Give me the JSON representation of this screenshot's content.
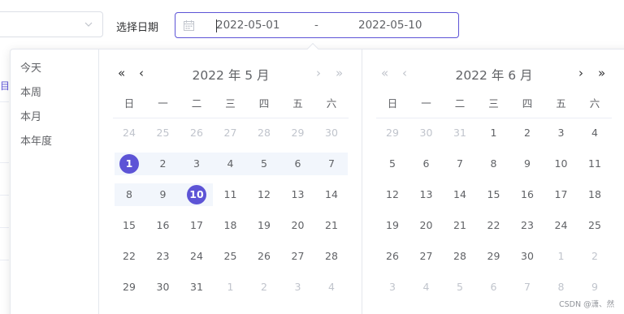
{
  "form": {
    "label": "选择日期"
  },
  "range": {
    "start": "2022-05-01",
    "separator": "-",
    "end": "2022-05-10"
  },
  "background": {
    "partial_text": "目"
  },
  "shortcuts": [
    "今天",
    "本周",
    "本月",
    "本年度"
  ],
  "left_month": {
    "title": "2022 年 5 月",
    "weekdays": [
      "日",
      "一",
      "二",
      "三",
      "四",
      "五",
      "六"
    ],
    "weeks": [
      [
        "24",
        "25",
        "26",
        "27",
        "28",
        "29",
        "30"
      ],
      [
        "1",
        "2",
        "3",
        "4",
        "5",
        "6",
        "7"
      ],
      [
        "8",
        "9",
        "10",
        "11",
        "12",
        "13",
        "14"
      ],
      [
        "15",
        "16",
        "17",
        "18",
        "19",
        "20",
        "21"
      ],
      [
        "22",
        "23",
        "24",
        "25",
        "26",
        "27",
        "28"
      ],
      [
        "29",
        "30",
        "31",
        "1",
        "2",
        "3",
        "4"
      ]
    ],
    "other_month": [
      [
        true,
        true,
        true,
        true,
        true,
        true,
        true
      ],
      [
        false,
        false,
        false,
        false,
        false,
        false,
        false
      ],
      [
        false,
        false,
        false,
        false,
        false,
        false,
        false
      ],
      [
        false,
        false,
        false,
        false,
        false,
        false,
        false
      ],
      [
        false,
        false,
        false,
        false,
        false,
        false,
        false
      ],
      [
        false,
        false,
        false,
        true,
        true,
        true,
        true
      ]
    ]
  },
  "right_month": {
    "title": "2022 年 6 月",
    "weekdays": [
      "日",
      "一",
      "二",
      "三",
      "四",
      "五",
      "六"
    ],
    "weeks": [
      [
        "29",
        "30",
        "31",
        "1",
        "2",
        "3",
        "4"
      ],
      [
        "5",
        "6",
        "7",
        "8",
        "9",
        "10",
        "11"
      ],
      [
        "12",
        "13",
        "14",
        "15",
        "16",
        "17",
        "18"
      ],
      [
        "19",
        "20",
        "21",
        "22",
        "23",
        "24",
        "25"
      ],
      [
        "26",
        "27",
        "28",
        "29",
        "30",
        "1",
        "2"
      ],
      [
        "3",
        "4",
        "5",
        "6",
        "7",
        "8",
        "9"
      ]
    ],
    "other_month": [
      [
        true,
        true,
        true,
        false,
        false,
        false,
        false
      ],
      [
        false,
        false,
        false,
        false,
        false,
        false,
        false
      ],
      [
        false,
        false,
        false,
        false,
        false,
        false,
        false
      ],
      [
        false,
        false,
        false,
        false,
        false,
        false,
        false
      ],
      [
        false,
        false,
        false,
        false,
        false,
        true,
        true
      ],
      [
        true,
        true,
        true,
        true,
        true,
        true,
        true
      ]
    ]
  },
  "selection": {
    "start_day": "1",
    "end_day": "10"
  },
  "nav_icons": {
    "prev_year": "«",
    "prev_month": "‹",
    "next_month": "›",
    "next_year": "»"
  },
  "colors": {
    "accent": "#5d54d6",
    "range_bg": "#f2f6fc",
    "muted": "#c0c4cc"
  },
  "watermark": "CSDN @潇、然"
}
